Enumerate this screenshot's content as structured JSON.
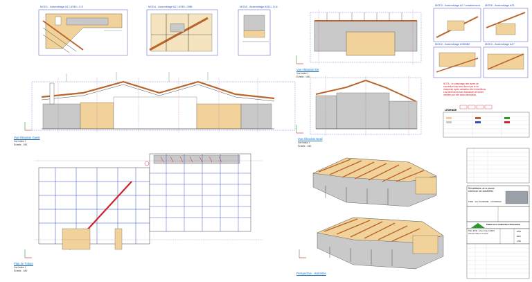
{
  "details": [
    {
      "title": "MOD1 - Assemblage AZ / ASB L.O.S"
    },
    {
      "title": "MOD4 - Assemblage AZ / ASB L.OBB"
    },
    {
      "title": "MOD5 - Assemblage ASB L.O.N"
    },
    {
      "title": "MOD3 - Assemblage AZ / entablement"
    },
    {
      "title": "MOD6 - Assemblage AZ1"
    },
    {
      "title": "MOD2 - Assemblage ASB5B2"
    },
    {
      "title": "MOD3 - Assemblage AZ7"
    }
  ],
  "views": {
    "sud": {
      "title": "Vue élévation Ouest",
      "scale": "Vue indice 1\nÉchelle : 1/50"
    },
    "est": {
      "title": "Vue élévation Est",
      "scale": "Vue indice 1\nÉchelle : 1/50"
    },
    "nord": {
      "title": "Vue élévation Nord",
      "scale": "Vue indice 1\nÉchelle : 1/50"
    },
    "plan": {
      "title": "Plan de Toiture",
      "scale": "Vue indice 1\nÉchelle : 1/50"
    },
    "persp": {
      "title": "Perspective - Isométrie"
    }
  },
  "note": "NOTA : Le calepinage des lames de couverture bois sera fourni par le lot charpente après validation des échantillons. Les dimensions sont indicatives et seront vérifiées sur site avant fabrication.",
  "legend": {
    "title": "LÉGENDE"
  },
  "titleblock": {
    "project": "Réhabilitation de la piscine extérieure de l'AUMOREL",
    "subtitle": "TORE · VAL D'AUMOREL · COURTENAY",
    "company": "PRED ECO CONSTRUCTION BOIS",
    "drawing": "Plan EXE - Vue zone 1&2&3 toiture bulle et couvrir",
    "cells": [
      "EXE",
      "REV",
      "1/50"
    ]
  },
  "colors": {
    "wood": "#f2d29b",
    "concrete": "#c9c9c9",
    "beam": "#b9652a",
    "blueline": "#2f4fbf",
    "redline": "#d0202a",
    "greenline": "#2a9a2a",
    "magenta": "#b23ab2"
  }
}
